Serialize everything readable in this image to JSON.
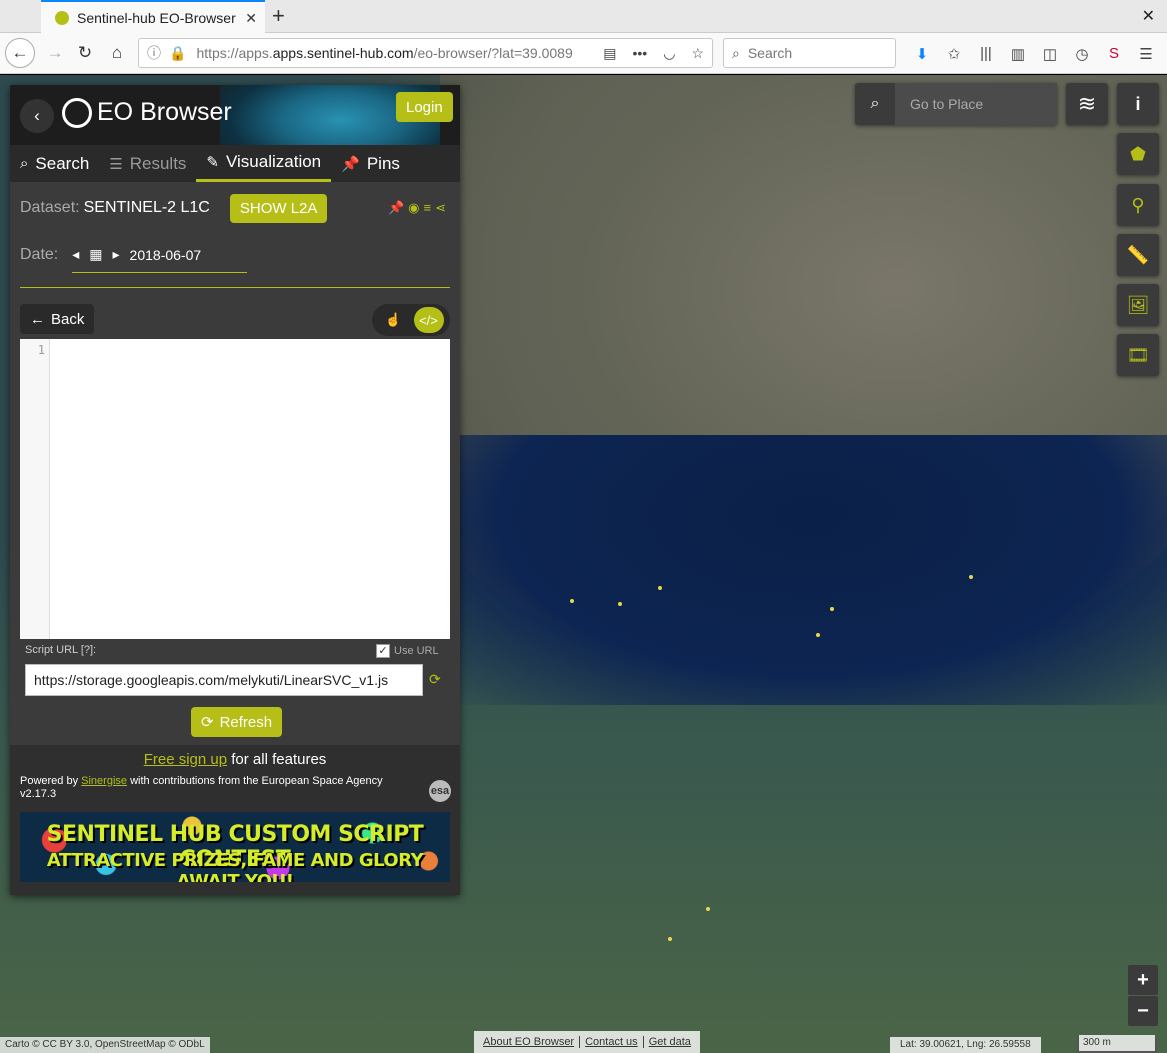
{
  "browser": {
    "tab_title": "Sentinel-hub EO-Browser",
    "url_domain": "apps.sentinel-hub.com",
    "url_prefix": "https://apps.",
    "url_rest": "/eo-browser/?lat=39.0089",
    "search_placeholder": "Search"
  },
  "header": {
    "app_name": "EO Browser",
    "login_label": "Login"
  },
  "tabs": [
    {
      "label": "Search",
      "icon": "search-icon"
    },
    {
      "label": "Results",
      "icon": "list-icon"
    },
    {
      "label": "Visualization",
      "icon": "brush-icon"
    },
    {
      "label": "Pins",
      "icon": "pin-icon"
    }
  ],
  "dataset": {
    "label": "Dataset:",
    "value": "SENTINEL-2 L1C",
    "show_l2a_label": "SHOW L2A"
  },
  "date": {
    "label": "Date:",
    "value": "2018-06-07"
  },
  "editor": {
    "back_label": "Back",
    "line_number": "1",
    "script_url_label": "Script URL [?]:",
    "use_url_label": "Use URL",
    "script_url": "https://storage.googleapis.com/melykuti/LinearSVC_v1.js",
    "refresh_label": "Refresh"
  },
  "footer": {
    "signup_link": "Free sign up",
    "signup_rest": " for all features",
    "powered_by": "Powered by ",
    "sinergise": "Sinergise",
    "contributions": " with contributions from the European Space Agency",
    "version": "v2.17.3",
    "banner_line1": "SENTINEL HUB CUSTOM SCRIPT CONTEST",
    "banner_line2": "ATTRACTIVE PRIZES, FAME AND GLORY AWAIT YOU!"
  },
  "map": {
    "goto_placeholder": "Go to Place",
    "attribution": "Carto © CC BY 3.0, OpenStreetMap © ODbL",
    "links": [
      "About EO Browser",
      "Contact us",
      "Get data"
    ],
    "latlng": "Lat: 39.00621, Lng: 26.59558",
    "scale": "300 m"
  },
  "colors": {
    "accent": "#b5bf17",
    "panel_bg": "#3b3b3b"
  }
}
